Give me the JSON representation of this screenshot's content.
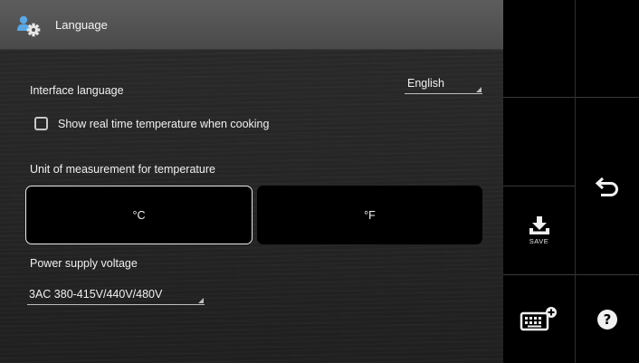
{
  "header": {
    "title": "Language",
    "icon": "user-settings-icon"
  },
  "interface_language": {
    "label": "Interface language",
    "value": "English"
  },
  "realtime_temp": {
    "label": "Show real time temperature when cooking",
    "checked": false
  },
  "temperature_unit": {
    "label": "Unit of measurement for temperature",
    "options": [
      "°C",
      "°F"
    ],
    "selected": "°C"
  },
  "power_supply": {
    "label": "Power supply voltage",
    "value": "3AC 380-415V/440V/480V"
  },
  "sidebar": {
    "save_label": "SAVE",
    "back_icon": "back-arrow-icon",
    "keyboard_icon": "keyboard-add-icon",
    "help_icon": "help-icon"
  },
  "colors": {
    "active_border": "#e8e8e8",
    "header_bg": "#555555",
    "panel_bg": "#000000"
  }
}
